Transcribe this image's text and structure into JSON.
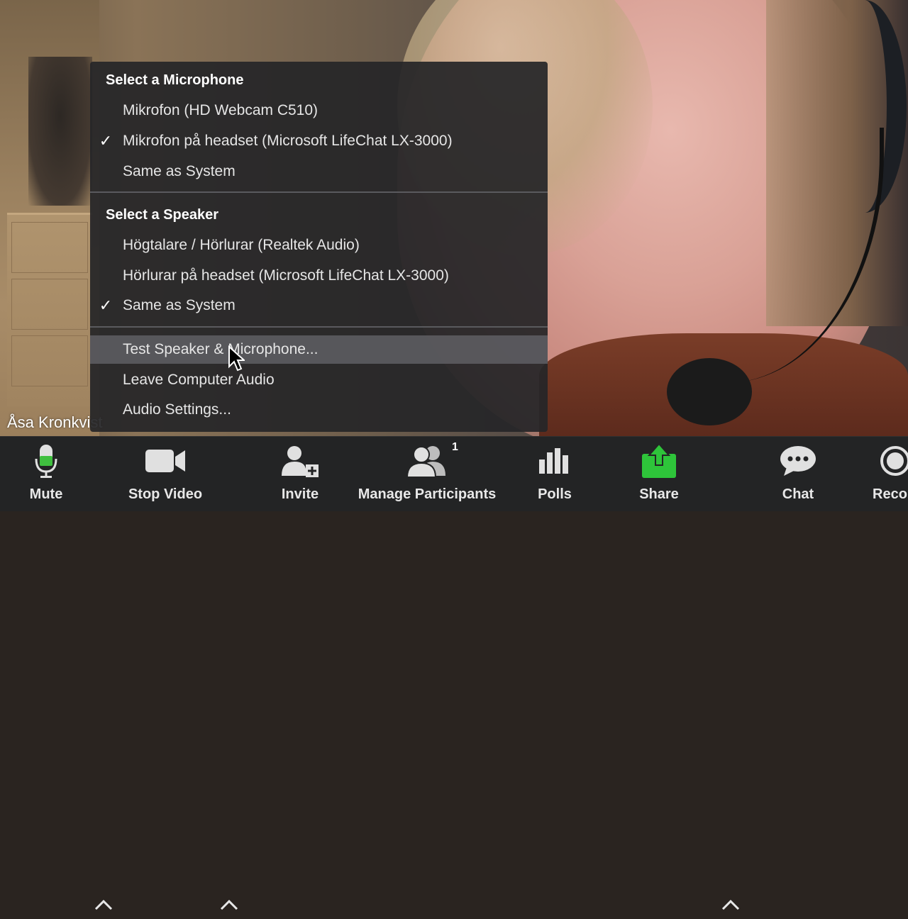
{
  "video": {
    "participant_name": "Åsa Kronkvist"
  },
  "audio_menu": {
    "microphone_header": "Select a Microphone",
    "microphones": [
      {
        "label": "Mikrofon (HD Webcam C510)",
        "checked": false
      },
      {
        "label": "Mikrofon på headset (Microsoft LifeChat LX-3000)",
        "checked": true
      },
      {
        "label": "Same as System",
        "checked": false
      }
    ],
    "speaker_header": "Select a Speaker",
    "speakers": [
      {
        "label": "Högtalare / Hörlurar (Realtek Audio)",
        "checked": false
      },
      {
        "label": "Hörlurar på headset (Microsoft LifeChat LX-3000)",
        "checked": false
      },
      {
        "label": "Same as System",
        "checked": true
      }
    ],
    "actions": [
      {
        "label": "Test Speaker & Microphone...",
        "hovered": true
      },
      {
        "label": "Leave Computer Audio",
        "hovered": false
      },
      {
        "label": "Audio Settings...",
        "hovered": false
      }
    ],
    "check_glyph": "✓"
  },
  "toolbar": {
    "mute_label": "Mute",
    "stop_video_label": "Stop Video",
    "invite_label": "Invite",
    "manage_participants_label": "Manage Participants",
    "participant_count": "1",
    "polls_label": "Polls",
    "share_label": "Share",
    "chat_label": "Chat",
    "record_label": "Reco"
  },
  "colors": {
    "mic_green": "#3fbf3f",
    "share_green": "#2ec43a",
    "toolbar_bg": "#232425",
    "menu_bg": "#262628"
  },
  "icons": [
    "microphone-icon",
    "video-camera-icon",
    "invite-person-icon",
    "participants-icon",
    "polls-icon",
    "share-screen-icon",
    "chat-bubble-icon",
    "record-icon",
    "caret-up-icon",
    "checkmark-icon",
    "mouse-cursor-icon"
  ]
}
